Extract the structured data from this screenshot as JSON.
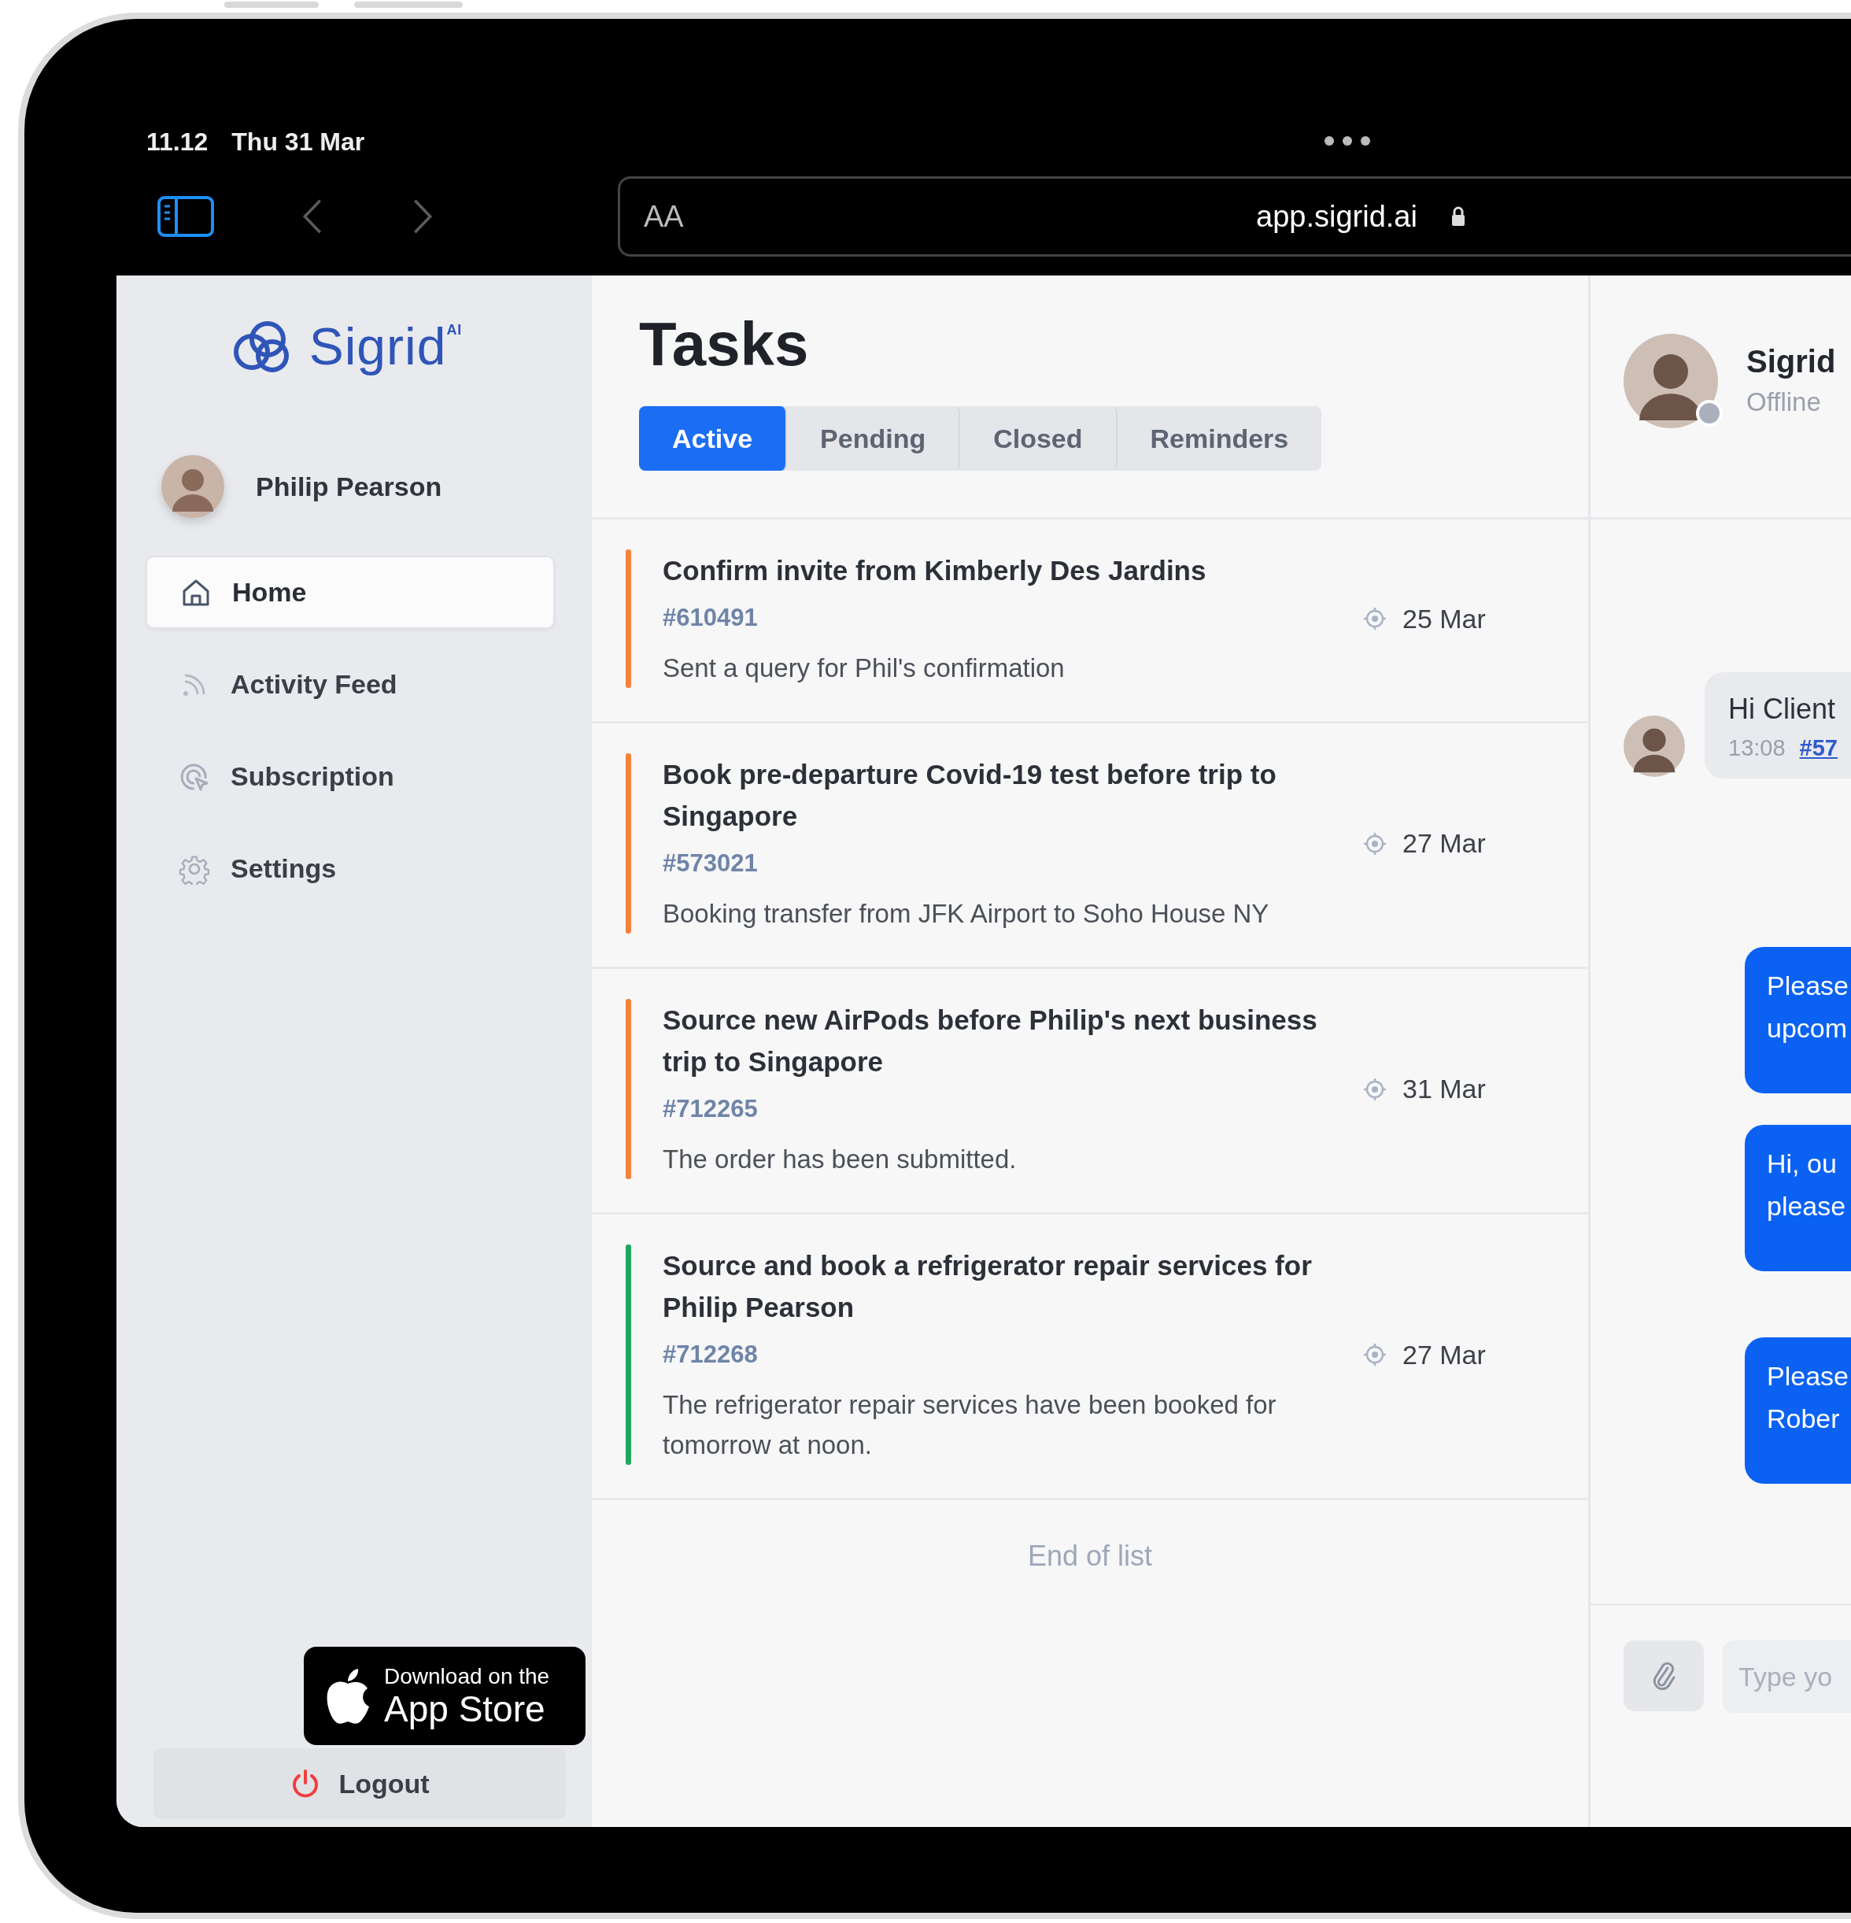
{
  "status_bar": {
    "time": "11.12",
    "date": "Thu 31 Mar"
  },
  "browser": {
    "text_size_label": "AA",
    "url": "app.sigrid.ai"
  },
  "sidebar": {
    "logo": "Sigrid$^{AI}$",
    "user": "Philip Pearson",
    "items": [
      {
        "label": "Home",
        "selected": true
      },
      {
        "label": "Activity Feed",
        "selected": false
      },
      {
        "label": "Subscription",
        "selected": false
      },
      {
        "label": "Settings",
        "selected": false
      }
    ],
    "app_store": {
      "line1": "Download on the",
      "line2": "App Store"
    },
    "logout": "Logout"
  },
  "tasks": {
    "title": "Tasks",
    "tabs": [
      {
        "label": "Active",
        "selected": true
      },
      {
        "label": "Pending",
        "selected": false
      },
      {
        "label": "Closed",
        "selected": false
      },
      {
        "label": "Reminders",
        "selected": false
      }
    ],
    "items": [
      {
        "title": "Confirm invite from Kimberly Des Jardins",
        "id": "#610491",
        "note": "Sent a query for Phil's confirmation",
        "date": "25 Mar",
        "color": "#f5823a"
      },
      {
        "title": "Book pre-departure Covid-19 test before trip to Singapore",
        "id": "#573021",
        "note": "Booking transfer from JFK Airport to Soho House NY",
        "date": "27 Mar",
        "color": "#f5823a"
      },
      {
        "title": "Source new AirPods before Philip's next business trip to Singapore",
        "id": "#712265",
        "note": "The order has been submitted.",
        "date": "31 Mar",
        "color": "#f5823a"
      },
      {
        "title": "Source and book a refrigerator repair services for Philip Pearson",
        "id": "#712268",
        "note": "The refrigerator repair services have been booked for tomorrow at noon.",
        "date": "27 Mar",
        "color": "#1fa85a"
      }
    ],
    "end_label": "End of list"
  },
  "chat": {
    "contact": "Sigrid",
    "status": "Offline",
    "messages": [
      {
        "kind": "incoming",
        "lines": [
          "Hi Client"
        ],
        "time": "13:08",
        "link": "#57"
      },
      {
        "kind": "outgoing",
        "lines": [
          "Please",
          "upcom"
        ]
      },
      {
        "kind": "outgoing",
        "lines": [
          "Hi, ou",
          "please"
        ]
      },
      {
        "kind": "outgoing",
        "lines": [
          "Please",
          "Rober"
        ]
      }
    ],
    "composer": {
      "placeholder": "Type yo"
    }
  }
}
